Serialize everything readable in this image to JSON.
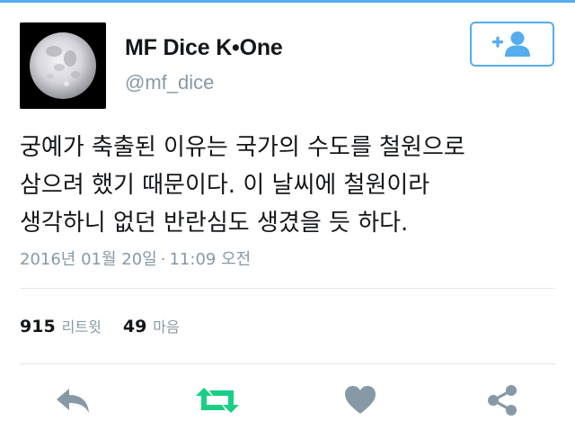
{
  "user": {
    "display_name": "MF Dice K•One",
    "handle": "@mf_dice"
  },
  "follow_button": {
    "icon": "add-user-icon"
  },
  "tweet": {
    "lines": [
      "궁예가 축출된 이유는 국가의 수도를 철원으로",
      "삼으려 했기 때문이다. 이 날씨에 철원이라",
      "생각하니 없던 반란심도 생겼을 듯 하다."
    ],
    "date": "2016년 01월 20일",
    "separator": "·",
    "time": "11:09 오전"
  },
  "stats": {
    "retweets": {
      "count": "915",
      "label": "리트윗"
    },
    "likes": {
      "count": "49",
      "label": "마음"
    }
  },
  "actions": [
    {
      "name": "reply",
      "icon": "reply-icon",
      "color": "#8899a6"
    },
    {
      "name": "retweet",
      "icon": "retweet-icon",
      "color": "#19cf86"
    },
    {
      "name": "like",
      "icon": "heart-icon",
      "color": "#8899a6"
    },
    {
      "name": "share",
      "icon": "share-icon",
      "color": "#8899a6"
    }
  ],
  "colors": {
    "accent": "#55acee",
    "muted": "#8899a6",
    "retweet_active": "#19cf86",
    "divider": "#e1e8ed"
  }
}
